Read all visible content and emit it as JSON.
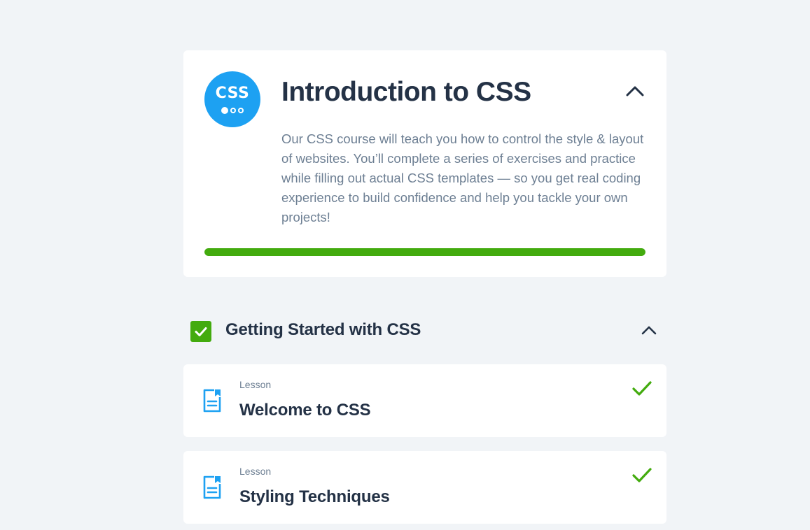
{
  "course": {
    "logo_text": "CSS",
    "title": "Introduction to CSS",
    "description": "Our CSS course will teach you how to control the style & layout of websites. You’ll complete a series of exercises and practice while filling out actual CSS templates — so you get real coding experience to build confidence and help you tackle your own projects!",
    "progress_percent": 100,
    "expanded": true
  },
  "section": {
    "title": "Getting Started with CSS",
    "completed": true,
    "expanded": true
  },
  "lessons": [
    {
      "type": "Lesson",
      "title": "Welcome to CSS",
      "completed": true
    },
    {
      "type": "Lesson",
      "title": "Styling Techniques",
      "completed": true
    }
  ],
  "colors": {
    "background": "#f1f4f7",
    "card": "#ffffff",
    "brand_blue": "#1da1f2",
    "success_green": "#43ab0e",
    "heading": "#243246",
    "muted_text": "#6d7f93"
  },
  "icons": {
    "collapse": "chevron-up-icon",
    "section_status": "checkbox-checked-icon",
    "lesson_type": "lesson-document-icon",
    "lesson_status": "checkmark-icon"
  }
}
